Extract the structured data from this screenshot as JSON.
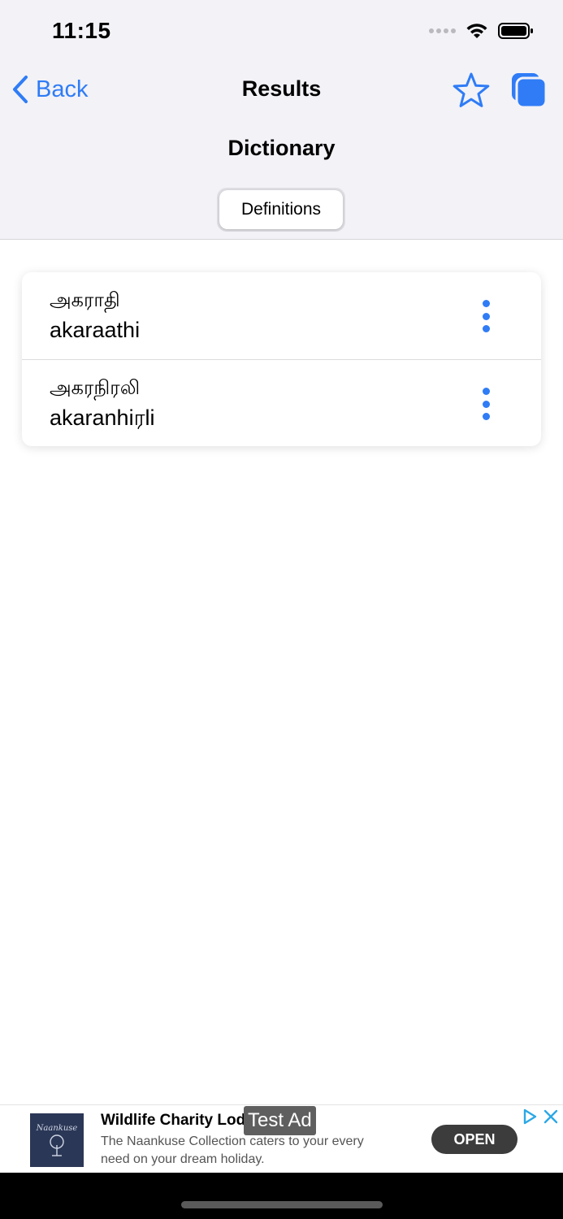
{
  "status_bar": {
    "time": "11:15"
  },
  "nav": {
    "back_label": "Back",
    "title": "Results"
  },
  "section_title": "Dictionary",
  "segment": {
    "label": "Definitions"
  },
  "results": [
    {
      "tamil": "அகராதி",
      "roman": "akaraathi"
    },
    {
      "tamil": "அகரநிரலி",
      "roman": "akaranhiரli"
    }
  ],
  "ad": {
    "title": "Wildlife Charity Lodge",
    "description": "The Naankuse Collection caters to your every need on your dream holiday.",
    "badge": "Test Ad",
    "open_label": "OPEN",
    "logo_text": "Naankuse"
  },
  "colors": {
    "accent": "#2f7cf6",
    "header_bg": "#f2f2f7"
  }
}
